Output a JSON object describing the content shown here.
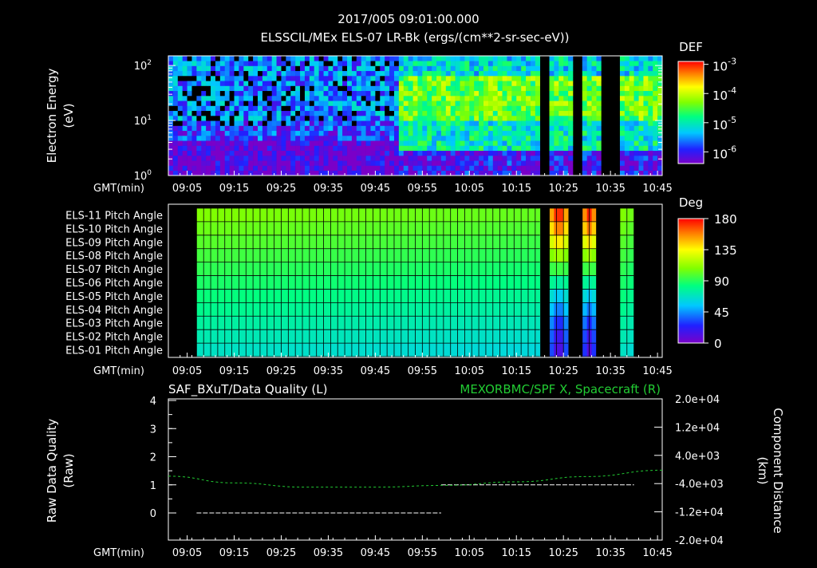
{
  "header": {
    "date_time": "2017/005 09:01:00.000",
    "title": "ELSSCIL/MEx ELS-07 LR-Bk  (ergs/(cm**2-sr-sec-eV))"
  },
  "colors": {
    "background": "#000000",
    "foreground": "#ffffff",
    "green_trace": "#22cc33",
    "colormap": [
      "#7a00c8",
      "#2020ff",
      "#00c8ff",
      "#00ff80",
      "#80ff00",
      "#ffff00",
      "#ff8000",
      "#ff0000"
    ]
  },
  "time_axis": {
    "label": "GMT(min)",
    "ticks": [
      "09:05",
      "09:15",
      "09:25",
      "09:35",
      "09:45",
      "09:55",
      "10:05",
      "10:15",
      "10:25",
      "10:35",
      "10:45"
    ],
    "start_minute": 0,
    "end_minute": 105
  },
  "panel1": {
    "ylabel_line1": "Electron Energy",
    "ylabel_line2": "(eV)",
    "yticks": [
      {
        "base": "10",
        "exp": "2"
      },
      {
        "base": "10",
        "exp": "1"
      },
      {
        "base": "10",
        "exp": "0"
      }
    ],
    "cbar_title": "DEF",
    "cbar_ticks": [
      {
        "base": "10",
        "exp": "-3"
      },
      {
        "base": "10",
        "exp": "-4"
      },
      {
        "base": "10",
        "exp": "-5"
      },
      {
        "base": "10",
        "exp": "-6"
      }
    ]
  },
  "panel2": {
    "channels": [
      "ELS-11 Pitch Angle",
      "ELS-10 Pitch Angle",
      "ELS-09 Pitch Angle",
      "ELS-08 Pitch Angle",
      "ELS-07 Pitch Angle",
      "ELS-06 Pitch Angle",
      "ELS-05 Pitch Angle",
      "ELS-04 Pitch Angle",
      "ELS-03 Pitch Angle",
      "ELS-02 Pitch Angle",
      "ELS-01 Pitch Angle"
    ],
    "cbar_title": "Deg",
    "cbar_ticks": [
      "180",
      "135",
      "90",
      "45",
      "0"
    ]
  },
  "panel3": {
    "left_title": "SAF_BXuT/Data Quality (L)",
    "right_title": "MEXORBMC/SPF X, Spacecraft (R)",
    "ylabel_left_line1": "Raw Data Quality",
    "ylabel_left_line2": "(Raw)",
    "ylabel_right_line1": "Component Distance",
    "ylabel_right_line2": "(km)",
    "yticks_left": [
      "4",
      "3",
      "2",
      "1",
      "0"
    ],
    "yticks_right": [
      "2.0e+04",
      "1.2e+04",
      "4.0e+03",
      "-4.0e+03",
      "-1.2e+04",
      "-2.0e+04"
    ]
  },
  "chart_data": [
    {
      "type": "heatmap",
      "title": "ELSSCIL/MEx ELS-07 LR-Bk  (ergs/(cm**2-sr-sec-eV))",
      "xlabel": "GMT(min)",
      "ylabel": "Electron Energy (eV)",
      "yscale": "log",
      "ylim": [
        1,
        150
      ],
      "zlabel": "DEF",
      "zscale": "log",
      "zlim": [
        1e-06,
        0.001
      ],
      "x_range": [
        "09:01",
        "10:46"
      ],
      "data_gaps": [
        [
          "10:20",
          "10:22"
        ],
        [
          "10:27",
          "10:29"
        ],
        [
          "10:33",
          "10:37"
        ]
      ],
      "bands": [
        {
          "from": "09:01",
          "to": "09:50",
          "energy_eV": [
            1,
            5
          ],
          "def": 1e-06
        },
        {
          "from": "09:50",
          "to": "10:46",
          "energy_eV": [
            10,
            60
          ],
          "def": 5e-05
        }
      ]
    },
    {
      "type": "heatmap",
      "xlabel": "GMT(min)",
      "categories": [
        "ELS-11",
        "ELS-10",
        "ELS-09",
        "ELS-08",
        "ELS-07",
        "ELS-06",
        "ELS-05",
        "ELS-04",
        "ELS-03",
        "ELS-02",
        "ELS-01"
      ],
      "zlabel": "Deg",
      "zlim": [
        0,
        180
      ],
      "coverage": [
        [
          "09:07",
          "10:20"
        ],
        [
          "10:22",
          "10:26"
        ],
        [
          "10:29",
          "10:32"
        ],
        [
          "10:37",
          "10:40"
        ]
      ],
      "pitch_angle_deg": [
        108,
        104,
        100,
        96,
        92,
        88,
        84,
        80,
        76,
        72,
        68
      ],
      "pitch_angle_deg_10_25": [
        175,
        160,
        140,
        115,
        95,
        75,
        55,
        40,
        25,
        15,
        10
      ]
    },
    {
      "type": "line",
      "xlabel": "GMT(min)",
      "ylabel": "Raw Data Quality (Raw)",
      "ylim": [
        0,
        4
      ],
      "series": [
        {
          "name": "SAF_BXuT/Data Quality",
          "axis": "left",
          "x": [
            "09:07",
            "09:59",
            "09:59",
            "10:40"
          ],
          "values": [
            0,
            0,
            1,
            1
          ]
        },
        {
          "name": "MEXORBMC/SPF X, Spacecraft",
          "axis": "right",
          "x": [
            "09:01",
            "09:15",
            "09:30",
            "09:45",
            "10:00",
            "10:15",
            "10:30",
            "10:46"
          ],
          "values": [
            -1900,
            -3800,
            -5000,
            -5000,
            -4500,
            -3500,
            -2000,
            -200
          ]
        }
      ],
      "ylim_right": [
        -20000,
        20000
      ]
    }
  ]
}
